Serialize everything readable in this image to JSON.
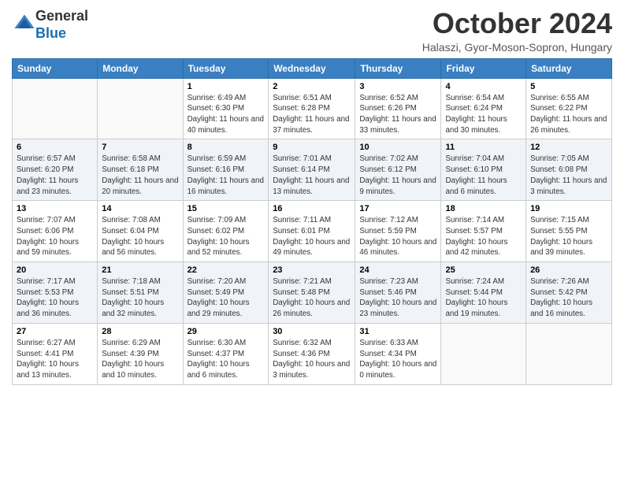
{
  "header": {
    "logo_general": "General",
    "logo_blue": "Blue",
    "month_title": "October 2024",
    "subtitle": "Halaszi, Gyor-Moson-Sopron, Hungary"
  },
  "days_of_week": [
    "Sunday",
    "Monday",
    "Tuesday",
    "Wednesday",
    "Thursday",
    "Friday",
    "Saturday"
  ],
  "weeks": [
    [
      {
        "day": "",
        "info": ""
      },
      {
        "day": "",
        "info": ""
      },
      {
        "day": "1",
        "info": "Sunrise: 6:49 AM\nSunset: 6:30 PM\nDaylight: 11 hours and 40 minutes."
      },
      {
        "day": "2",
        "info": "Sunrise: 6:51 AM\nSunset: 6:28 PM\nDaylight: 11 hours and 37 minutes."
      },
      {
        "day": "3",
        "info": "Sunrise: 6:52 AM\nSunset: 6:26 PM\nDaylight: 11 hours and 33 minutes."
      },
      {
        "day": "4",
        "info": "Sunrise: 6:54 AM\nSunset: 6:24 PM\nDaylight: 11 hours and 30 minutes."
      },
      {
        "day": "5",
        "info": "Sunrise: 6:55 AM\nSunset: 6:22 PM\nDaylight: 11 hours and 26 minutes."
      }
    ],
    [
      {
        "day": "6",
        "info": "Sunrise: 6:57 AM\nSunset: 6:20 PM\nDaylight: 11 hours and 23 minutes."
      },
      {
        "day": "7",
        "info": "Sunrise: 6:58 AM\nSunset: 6:18 PM\nDaylight: 11 hours and 20 minutes."
      },
      {
        "day": "8",
        "info": "Sunrise: 6:59 AM\nSunset: 6:16 PM\nDaylight: 11 hours and 16 minutes."
      },
      {
        "day": "9",
        "info": "Sunrise: 7:01 AM\nSunset: 6:14 PM\nDaylight: 11 hours and 13 minutes."
      },
      {
        "day": "10",
        "info": "Sunrise: 7:02 AM\nSunset: 6:12 PM\nDaylight: 11 hours and 9 minutes."
      },
      {
        "day": "11",
        "info": "Sunrise: 7:04 AM\nSunset: 6:10 PM\nDaylight: 11 hours and 6 minutes."
      },
      {
        "day": "12",
        "info": "Sunrise: 7:05 AM\nSunset: 6:08 PM\nDaylight: 11 hours and 3 minutes."
      }
    ],
    [
      {
        "day": "13",
        "info": "Sunrise: 7:07 AM\nSunset: 6:06 PM\nDaylight: 10 hours and 59 minutes."
      },
      {
        "day": "14",
        "info": "Sunrise: 7:08 AM\nSunset: 6:04 PM\nDaylight: 10 hours and 56 minutes."
      },
      {
        "day": "15",
        "info": "Sunrise: 7:09 AM\nSunset: 6:02 PM\nDaylight: 10 hours and 52 minutes."
      },
      {
        "day": "16",
        "info": "Sunrise: 7:11 AM\nSunset: 6:01 PM\nDaylight: 10 hours and 49 minutes."
      },
      {
        "day": "17",
        "info": "Sunrise: 7:12 AM\nSunset: 5:59 PM\nDaylight: 10 hours and 46 minutes."
      },
      {
        "day": "18",
        "info": "Sunrise: 7:14 AM\nSunset: 5:57 PM\nDaylight: 10 hours and 42 minutes."
      },
      {
        "day": "19",
        "info": "Sunrise: 7:15 AM\nSunset: 5:55 PM\nDaylight: 10 hours and 39 minutes."
      }
    ],
    [
      {
        "day": "20",
        "info": "Sunrise: 7:17 AM\nSunset: 5:53 PM\nDaylight: 10 hours and 36 minutes."
      },
      {
        "day": "21",
        "info": "Sunrise: 7:18 AM\nSunset: 5:51 PM\nDaylight: 10 hours and 32 minutes."
      },
      {
        "day": "22",
        "info": "Sunrise: 7:20 AM\nSunset: 5:49 PM\nDaylight: 10 hours and 29 minutes."
      },
      {
        "day": "23",
        "info": "Sunrise: 7:21 AM\nSunset: 5:48 PM\nDaylight: 10 hours and 26 minutes."
      },
      {
        "day": "24",
        "info": "Sunrise: 7:23 AM\nSunset: 5:46 PM\nDaylight: 10 hours and 23 minutes."
      },
      {
        "day": "25",
        "info": "Sunrise: 7:24 AM\nSunset: 5:44 PM\nDaylight: 10 hours and 19 minutes."
      },
      {
        "day": "26",
        "info": "Sunrise: 7:26 AM\nSunset: 5:42 PM\nDaylight: 10 hours and 16 minutes."
      }
    ],
    [
      {
        "day": "27",
        "info": "Sunrise: 6:27 AM\nSunset: 4:41 PM\nDaylight: 10 hours and 13 minutes."
      },
      {
        "day": "28",
        "info": "Sunrise: 6:29 AM\nSunset: 4:39 PM\nDaylight: 10 hours and 10 minutes."
      },
      {
        "day": "29",
        "info": "Sunrise: 6:30 AM\nSunset: 4:37 PM\nDaylight: 10 hours and 6 minutes."
      },
      {
        "day": "30",
        "info": "Sunrise: 6:32 AM\nSunset: 4:36 PM\nDaylight: 10 hours and 3 minutes."
      },
      {
        "day": "31",
        "info": "Sunrise: 6:33 AM\nSunset: 4:34 PM\nDaylight: 10 hours and 0 minutes."
      },
      {
        "day": "",
        "info": ""
      },
      {
        "day": "",
        "info": ""
      }
    ]
  ]
}
